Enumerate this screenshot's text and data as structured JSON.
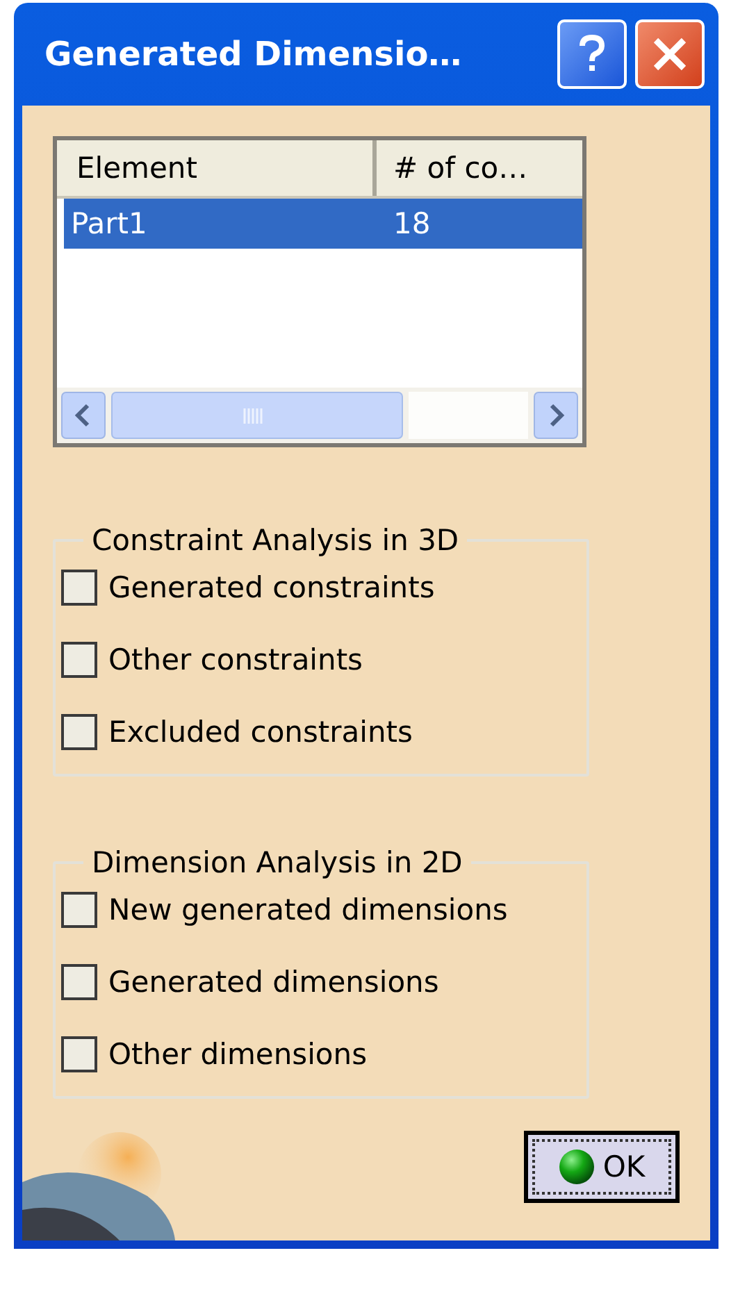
{
  "window": {
    "title": "Generated Dimensio…"
  },
  "table": {
    "columns": [
      "Element",
      "# of co…"
    ],
    "rows": [
      {
        "cells": [
          "Part1",
          "18"
        ],
        "selected": true
      }
    ]
  },
  "groups": [
    {
      "title": "Constraint Analysis in 3D",
      "options": [
        {
          "label": "Generated constraints",
          "checked": false
        },
        {
          "label": "Other constraints",
          "checked": false
        },
        {
          "label": "Excluded constraints",
          "checked": false
        }
      ]
    },
    {
      "title": "Dimension Analysis in 2D",
      "options": [
        {
          "label": "New generated dimensions",
          "checked": false
        },
        {
          "label": "Generated dimensions",
          "checked": false
        },
        {
          "label": "Other dimensions",
          "checked": false
        }
      ]
    }
  ],
  "ok_button": {
    "label": "OK"
  }
}
